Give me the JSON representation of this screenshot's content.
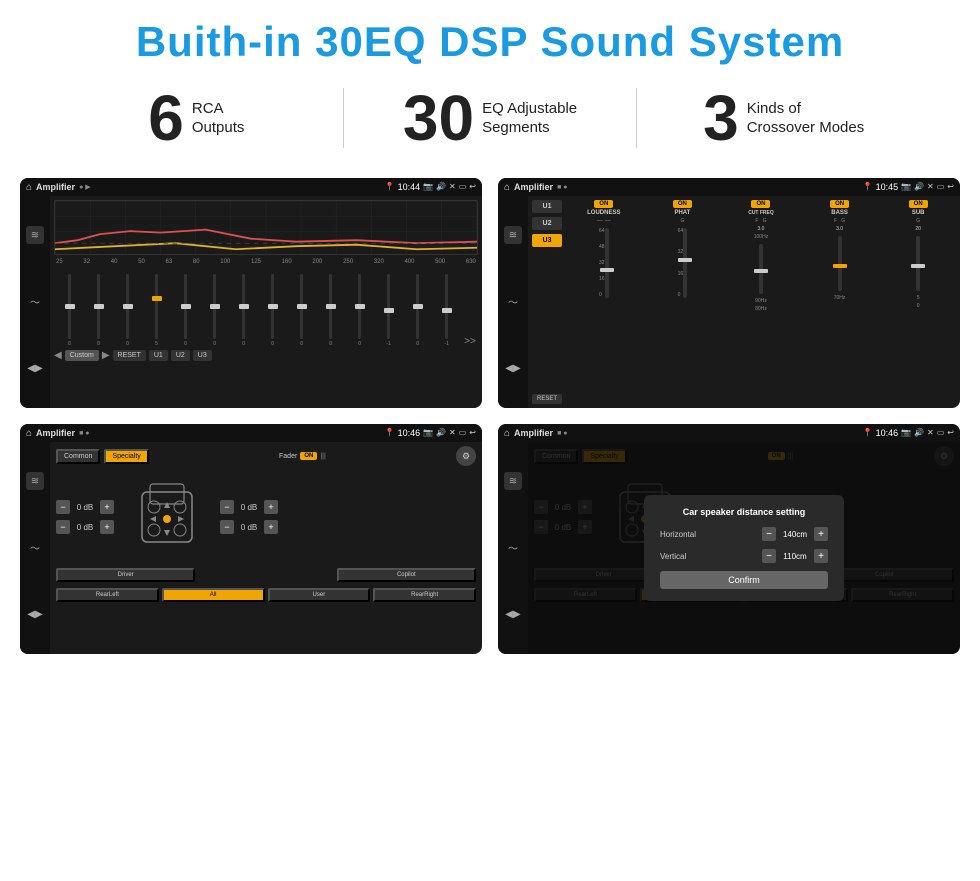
{
  "header": {
    "title": "Buith-in 30EQ DSP Sound System"
  },
  "stats": [
    {
      "number": "6",
      "label_line1": "RCA",
      "label_line2": "Outputs"
    },
    {
      "number": "30",
      "label_line1": "EQ Adjustable",
      "label_line2": "Segments"
    },
    {
      "number": "3",
      "label_line1": "Kinds of",
      "label_line2": "Crossover Modes"
    }
  ],
  "screens": {
    "eq": {
      "topbar_title": "Amplifier",
      "time": "10:44",
      "freq_labels": [
        "25",
        "32",
        "40",
        "50",
        "63",
        "80",
        "100",
        "125",
        "160",
        "200",
        "250",
        "320",
        "400",
        "500",
        "630"
      ],
      "slider_values": [
        "0",
        "0",
        "0",
        "5",
        "0",
        "0",
        "0",
        "0",
        "0",
        "0",
        "0",
        "-1",
        "0",
        "-1"
      ],
      "bottom_buttons": [
        "Custom",
        "RESET",
        "U1",
        "U2",
        "U3"
      ]
    },
    "crossover": {
      "topbar_title": "Amplifier",
      "time": "10:45",
      "presets": [
        "U1",
        "U2",
        "U3"
      ],
      "channels": [
        {
          "label": "LOUDNESS",
          "on": true
        },
        {
          "label": "PHAT",
          "on": true
        },
        {
          "label": "CUT FREQ",
          "on": true
        },
        {
          "label": "BASS",
          "on": true
        },
        {
          "label": "SUB",
          "on": true
        }
      ]
    },
    "fader": {
      "topbar_title": "Amplifier",
      "time": "10:46",
      "tabs": [
        "Common",
        "Specialty"
      ],
      "fader_label": "Fader",
      "fader_on": "ON",
      "controls_left": [
        {
          "value": "0 dB"
        },
        {
          "value": "0 dB"
        }
      ],
      "controls_right": [
        {
          "value": "0 dB"
        },
        {
          "value": "0 dB"
        }
      ],
      "bottom_buttons": [
        "Driver",
        "",
        "Copilot",
        "RearLeft",
        "All",
        "User",
        "RearRight"
      ],
      "all_active": true
    },
    "dialog": {
      "topbar_title": "Amplifier",
      "time": "10:46",
      "tabs": [
        "Common",
        "Specialty"
      ],
      "dialog_title": "Car speaker distance setting",
      "horizontal_label": "Horizontal",
      "horizontal_value": "140cm",
      "vertical_label": "Vertical",
      "vertical_value": "110cm",
      "confirm_label": "Confirm",
      "controls_right": [
        {
          "value": "0 dB"
        },
        {
          "value": "0 dB"
        }
      ],
      "bottom_buttons": [
        "Driver",
        "",
        "Copilot",
        "RearLeft",
        "All",
        "User",
        "RearRight"
      ]
    }
  }
}
